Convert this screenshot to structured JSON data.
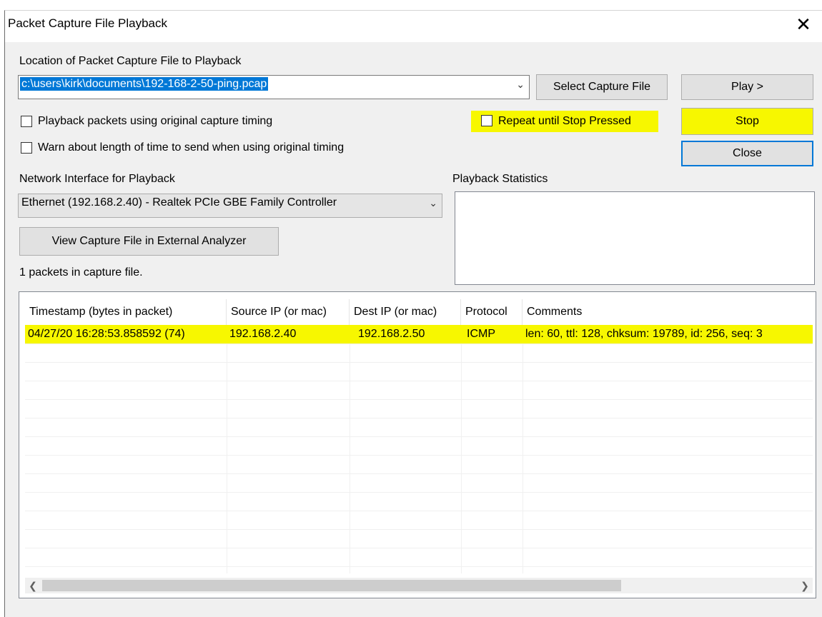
{
  "window": {
    "title": "Packet Capture File Playback"
  },
  "capture_file": {
    "label": "Location of Packet Capture File to Playback",
    "value": "c:\\users\\kirk\\documents\\192-168-2-50-ping.pcap",
    "select_button": "Select Capture File"
  },
  "buttons": {
    "play": "Play >",
    "stop": "Stop",
    "close": "Close",
    "view_external": "View Capture File in External Analyzer"
  },
  "options": {
    "original_timing": {
      "label": "Playback packets using original capture timing",
      "checked": false
    },
    "warn_length": {
      "label": "Warn about length of time to send when using original timing",
      "checked": false
    },
    "repeat": {
      "label": "Repeat until Stop Pressed",
      "checked": false
    }
  },
  "network": {
    "label": "Network Interface for Playback",
    "value": "Ethernet (192.168.2.40) - Realtek PCIe GBE Family Controller"
  },
  "stats": {
    "label": "Playback Statistics"
  },
  "packet_count": "1 packets in capture file.",
  "table": {
    "columns": [
      "Timestamp (bytes in packet)",
      "Source IP (or mac)",
      "Dest IP (or mac)",
      "Protocol",
      "Comments"
    ],
    "rows": [
      [
        "04/27/20 16:28:53.858592 (74)",
        "192.168.2.40",
        "192.168.2.50",
        "ICMP",
        "len: 60, ttl: 128, chksum: 19789, id: 256, seq: 3"
      ]
    ]
  },
  "colors": {
    "highlight": "#f7f700",
    "selection": "#0078d7",
    "focus_border": "#0078d7"
  },
  "icons": {
    "close": "close-icon",
    "dropdown": "chevron-down-icon",
    "scroll_left": "chevron-left-icon",
    "scroll_right": "chevron-right-icon"
  }
}
